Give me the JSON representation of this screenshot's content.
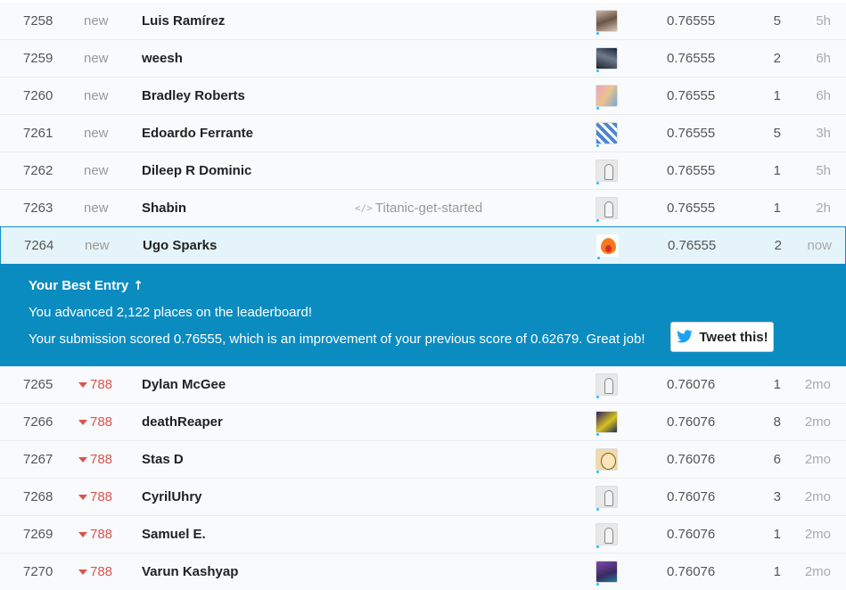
{
  "rows_top": [
    {
      "rank": "7258",
      "delta": "new",
      "name": "Luis Ramírez",
      "kernel": "",
      "avatar": "photo1",
      "score": "0.76555",
      "entries": "5",
      "last": "5h"
    },
    {
      "rank": "7259",
      "delta": "new",
      "name": "weesh",
      "kernel": "",
      "avatar": "photo2",
      "score": "0.76555",
      "entries": "2",
      "last": "6h"
    },
    {
      "rank": "7260",
      "delta": "new",
      "name": "Bradley Roberts",
      "kernel": "",
      "avatar": "photo3",
      "score": "0.76555",
      "entries": "1",
      "last": "6h"
    },
    {
      "rank": "7261",
      "delta": "new",
      "name": "Edoardo Ferrante",
      "kernel": "",
      "avatar": "pattern",
      "score": "0.76555",
      "entries": "5",
      "last": "3h"
    },
    {
      "rank": "7262",
      "delta": "new",
      "name": "Dileep R Dominic",
      "kernel": "",
      "avatar": "goose",
      "score": "0.76555",
      "entries": "1",
      "last": "5h"
    },
    {
      "rank": "7263",
      "delta": "new",
      "name": "Shabin",
      "kernel": "Titanic-get-started",
      "avatar": "goose",
      "score": "0.76555",
      "entries": "1",
      "last": "2h"
    }
  ],
  "highlight_row": {
    "rank": "7264",
    "delta": "new",
    "name": "Ugo Sparks",
    "avatar": "fire",
    "score": "0.76555",
    "entries": "2",
    "last": "now"
  },
  "best_entry": {
    "title": "Your Best Entry",
    "up_arrow": "🡑",
    "line1": "You advanced 2,122 places on the leaderboard!",
    "line2": "Your submission scored 0.76555, which is an improvement of your previous score of 0.62679. Great job!",
    "tweet_label": "Tweet this!"
  },
  "rows_bottom": [
    {
      "rank": "7265",
      "delta": "788",
      "name": "Dylan McGee",
      "avatar": "goose",
      "score": "0.76076",
      "entries": "1",
      "last": "2mo"
    },
    {
      "rank": "7266",
      "delta": "788",
      "name": "deathReaper",
      "avatar": "dark1",
      "score": "0.76076",
      "entries": "8",
      "last": "2mo"
    },
    {
      "rank": "7267",
      "delta": "788",
      "name": "Stas D",
      "avatar": "cartoon",
      "score": "0.76076",
      "entries": "6",
      "last": "2mo"
    },
    {
      "rank": "7268",
      "delta": "788",
      "name": "CyrilUhry",
      "avatar": "goose",
      "score": "0.76076",
      "entries": "3",
      "last": "2mo"
    },
    {
      "rank": "7269",
      "delta": "788",
      "name": "Samuel E.",
      "avatar": "goose",
      "score": "0.76076",
      "entries": "1",
      "last": "2mo"
    },
    {
      "rank": "7270",
      "delta": "788",
      "name": "Varun Kashyap",
      "avatar": "purple",
      "score": "0.76076",
      "entries": "1",
      "last": "2mo"
    }
  ],
  "colors": {
    "accent": "#0b8cc1",
    "down": "#d9534f",
    "tier_dot": "#20beff",
    "twitter": "#1da1f2"
  }
}
